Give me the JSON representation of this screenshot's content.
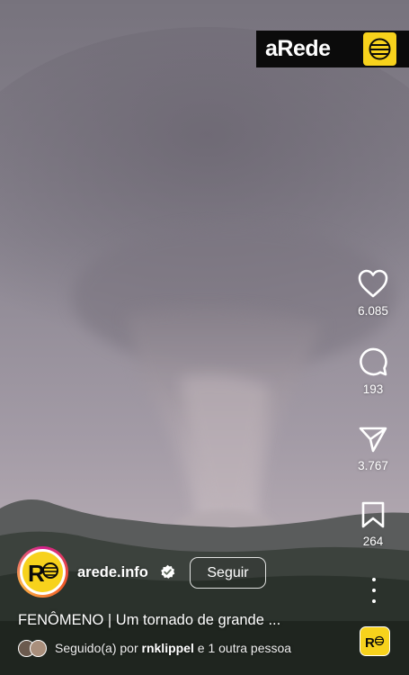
{
  "brand": {
    "name": "aRede",
    "logo_icon": "arede-logo-icon"
  },
  "actions": {
    "like_count": "6.085",
    "comment_count": "193",
    "share_count": "3.767",
    "save_count": "264"
  },
  "account": {
    "username": "arede.info",
    "follow_label": "Seguir",
    "avatar_letter": "R"
  },
  "caption": "FENÔMENO | Um tornado de grande ...",
  "followed_by": {
    "prefix": "Seguido(a) por",
    "user": "rnklippel",
    "suffix": "e 1 outra pessoa"
  },
  "colors": {
    "brand_yellow": "#f7d21c",
    "brand_black": "#0b0b0b"
  }
}
